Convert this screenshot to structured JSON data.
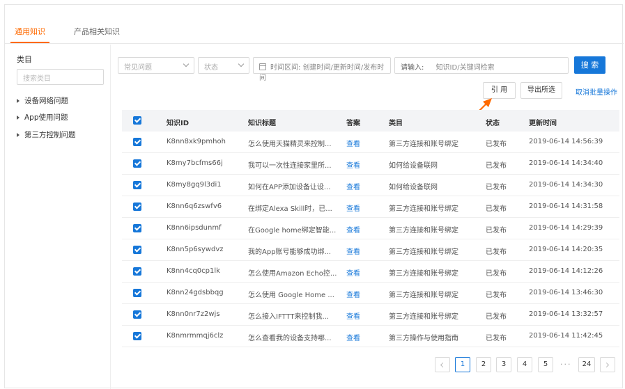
{
  "tabs": [
    {
      "label": "通用知识",
      "active": true
    },
    {
      "label": "产品相关知识",
      "active": false
    }
  ],
  "sidebar": {
    "title": "类目",
    "search_placeholder": "搜索类目",
    "items": [
      {
        "label": "设备网络问题"
      },
      {
        "label": "App使用问题"
      },
      {
        "label": "第三方控制问题"
      }
    ]
  },
  "filters": {
    "common_question": "常见问题",
    "status": "状态",
    "time_range": "时间区间: 创建时间/更新时间/发布时间",
    "input_label": "请输入:",
    "input_placeholder": "知识ID/关键词检索",
    "search_button": "搜 索"
  },
  "actions": {
    "cite": "引 用",
    "export": "导出所选",
    "cancel_batch": "取消批量操作"
  },
  "table": {
    "headers": [
      "知识ID",
      "知识标题",
      "答案",
      "类目",
      "状态",
      "更新时间"
    ],
    "rows": [
      {
        "id": "K8nn8xk9pmhoh",
        "title": "怎么使用天猫精灵来控制...",
        "answer": "查看",
        "category": "第三方连接和账号绑定",
        "status": "已发布",
        "time": "2019-06-14 14:56:39"
      },
      {
        "id": "K8my7bcfms66j",
        "title": "我可以一次性连接家里所...",
        "answer": "查看",
        "category": "如何给设备联网",
        "status": "已发布",
        "time": "2019-06-14 14:34:40"
      },
      {
        "id": "K8my8gq9l3di1",
        "title": "如何在APP添加设备让设...",
        "answer": "查看",
        "category": "如何给设备联网",
        "status": "已发布",
        "time": "2019-06-14 14:34:30"
      },
      {
        "id": "K8nn6q6zswfv6",
        "title": "在绑定Alexa Skill时，已...",
        "answer": "查看",
        "category": "第三方连接和账号绑定",
        "status": "已发布",
        "time": "2019-06-14 14:31:58"
      },
      {
        "id": "K8nn6ipsdunmf",
        "title": "在Google home绑定智能...",
        "answer": "查看",
        "category": "第三方连接和账号绑定",
        "status": "已发布",
        "time": "2019-06-14 14:29:39"
      },
      {
        "id": "K8nn5p6sywdvz",
        "title": "我的App账号能够成功绑...",
        "answer": "查看",
        "category": "第三方连接和账号绑定",
        "status": "已发布",
        "time": "2019-06-14 14:20:35"
      },
      {
        "id": "K8nn4cq0cp1lk",
        "title": "怎么使用Amazon Echo控...",
        "answer": "查看",
        "category": "第三方连接和账号绑定",
        "status": "已发布",
        "time": "2019-06-14 14:12:26"
      },
      {
        "id": "K8nn24gdsbbqg",
        "title": "怎么使用 Google Home ...",
        "answer": "查看",
        "category": "第三方连接和账号绑定",
        "status": "已发布",
        "time": "2019-06-14 13:46:30"
      },
      {
        "id": "K8nn0nr7z2wjs",
        "title": "怎么接入IFTTT来控制我...",
        "answer": "查看",
        "category": "第三方连接和账号绑定",
        "status": "已发布",
        "time": "2019-06-14 13:32:57"
      },
      {
        "id": "K8nmrmmqj6clz",
        "title": "怎么查看我的设备支持哪...",
        "answer": "查看",
        "category": "第三方操作与使用指南",
        "status": "已发布",
        "time": "2019-06-14 11:42:45"
      }
    ]
  },
  "pagination": {
    "pages": [
      "1",
      "2",
      "3",
      "4",
      "5"
    ],
    "ellipsis": "···",
    "last": "24",
    "current": "1"
  },
  "colors": {
    "accent": "#1677d9",
    "tab_active": "#ff6a00",
    "annotation_arrow": "#ff6a00"
  }
}
